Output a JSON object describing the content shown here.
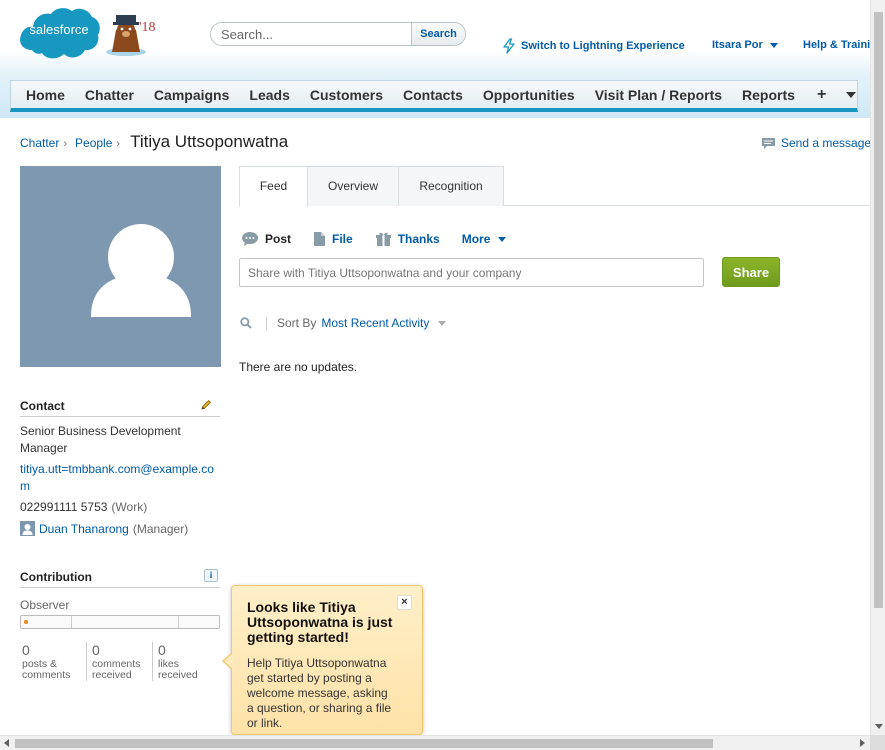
{
  "brand": {
    "logo_text": "salesforce",
    "mascot_year": "'18",
    "colors": {
      "brand_blue": "#1798c1",
      "link": "#015ba7",
      "share_green": "#7aa823",
      "avatar_bg": "#7f98b2",
      "tip_bg": "#fee2a8"
    }
  },
  "header": {
    "search_placeholder": "Search...",
    "search_button": "Search",
    "switch_link": "Switch to Lightning Experience",
    "user_name": "Itsara Por",
    "help_link": "Help & Training"
  },
  "tabs": [
    "Home",
    "Chatter",
    "Campaigns",
    "Leads",
    "Customers",
    "Contacts",
    "Opportunities",
    "Visit Plan / Reports",
    "Reports"
  ],
  "tab_plus": "+",
  "breadcrumb": {
    "items": [
      "Chatter",
      "People"
    ],
    "separator": "›",
    "title": "Titiya Uttsoponwatna"
  },
  "send_message": "Send a message",
  "profile_tabs": [
    "Feed",
    "Overview",
    "Recognition"
  ],
  "publisher": {
    "actions": [
      "Post",
      "File",
      "Thanks",
      "More"
    ],
    "placeholder": "Share with Titiya Uttsoponwatna and your company",
    "share_button": "Share"
  },
  "sort": {
    "label": "Sort By",
    "value": "Most Recent Activity"
  },
  "feed": {
    "empty_text": "There are no updates."
  },
  "contact": {
    "heading": "Contact",
    "title": "Senior Business Development Manager",
    "email": "titiya.utt=tmbbank.com@example.com",
    "phone": "022991111 5753",
    "phone_type": "(Work)",
    "manager_name": "Duan Thanarong",
    "manager_role": "(Manager)"
  },
  "contribution": {
    "heading": "Contribution",
    "info": "i",
    "level": "Observer",
    "stats": [
      {
        "count": "0",
        "label": "posts & comments"
      },
      {
        "count": "0",
        "label": "comments received"
      },
      {
        "count": "0",
        "label": "likes received"
      }
    ]
  },
  "tip": {
    "title": "Looks like Titiya Uttsoponwatna is just getting started!",
    "body": "Help Titiya Uttsoponwatna get started by posting a welcome message, asking a question, or sharing a file or link.",
    "close": "×"
  }
}
